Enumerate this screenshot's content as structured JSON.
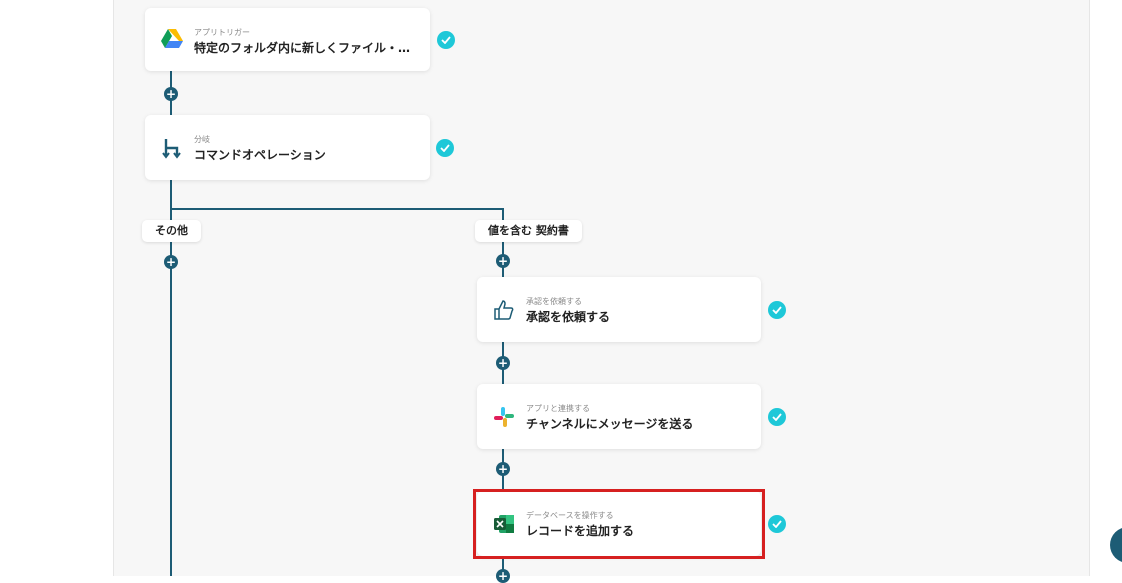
{
  "flow": {
    "step1": {
      "label": "アプリトリガー",
      "title": "特定のフォルダ内に新しくファイル・…",
      "icon": "google-drive-icon",
      "status": "complete"
    },
    "step2": {
      "label": "分岐",
      "title": "コマンドオペレーション",
      "icon": "branch-icon",
      "status": "complete"
    },
    "branches": {
      "left": {
        "label": "その他"
      },
      "right": {
        "label": "値を含む 契約書"
      }
    },
    "step3": {
      "label": "承認を依頼する",
      "title": "承認を依頼する",
      "icon": "thumbs-up-icon",
      "status": "complete"
    },
    "step4": {
      "label": "アプリと連携する",
      "title": "チャンネルにメッセージを送る",
      "icon": "slack-icon",
      "status": "complete"
    },
    "step5": {
      "label": "データベースを操作する",
      "title": "レコードを追加する",
      "icon": "excel-icon",
      "status": "complete",
      "highlighted": true
    }
  },
  "colors": {
    "connector": "#1d5c75",
    "check": "#1ec8d8",
    "highlight": "#d62020",
    "canvas": "#f7f7f7"
  }
}
